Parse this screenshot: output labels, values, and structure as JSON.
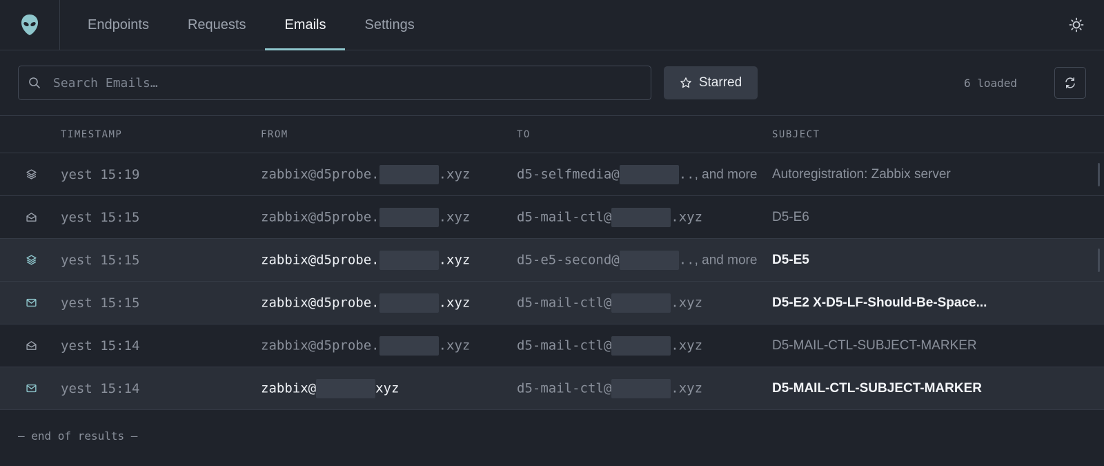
{
  "nav": {
    "tabs": [
      "Endpoints",
      "Requests",
      "Emails",
      "Settings"
    ],
    "active": "Emails"
  },
  "toolbar": {
    "search_placeholder": "Search Emails…",
    "starred_label": "Starred",
    "loaded_text": "6 loaded"
  },
  "table": {
    "headers": [
      "TIMESTAMP",
      "FROM",
      "TO",
      "SUBJECT"
    ],
    "rows": [
      {
        "icon": "layers-icon",
        "ts": "yest 15:19",
        "from_pre": "zabbix@d5probe.",
        "from_post": ".xyz",
        "to_pre": "d5-selfmedia@",
        "to_post": "..",
        "to_more": ", and more",
        "subject": "Autoregistration: Zabbix server"
      },
      {
        "icon": "mail-open-icon",
        "ts": "yest 15:15",
        "from_pre": "zabbix@d5probe.",
        "from_post": ".xyz",
        "to_pre": "d5-mail-ctl@",
        "to_post": ".xyz",
        "to_more": "",
        "subject": "D5-E6"
      },
      {
        "icon": "layers-icon",
        "ts": "yest 15:15",
        "from_pre": "zabbix@d5probe.",
        "from_post": ".xyz",
        "to_pre": "d5-e5-second@",
        "to_post": "..",
        "to_more": ", and more",
        "subject": "D5-E5"
      },
      {
        "icon": "mail-icon",
        "ts": "yest 15:15",
        "from_pre": "zabbix@d5probe.",
        "from_post": ".xyz",
        "to_pre": "d5-mail-ctl@",
        "to_post": ".xyz",
        "to_more": "",
        "subject": "D5-E2 X-D5-LF-Should-Be-Space..."
      },
      {
        "icon": "mail-open-icon",
        "ts": "yest 15:14",
        "from_pre": "zabbix@d5probe.",
        "from_post": ".xyz",
        "to_pre": "d5-mail-ctl@",
        "to_post": ".xyz",
        "to_more": "",
        "subject": "D5-MAIL-CTL-SUBJECT-MARKER"
      },
      {
        "icon": "mail-icon",
        "ts": "yest 15:14",
        "from_pre": "zabbix@",
        "from_post": "xyz",
        "to_pre": "d5-mail-ctl@",
        "to_post": ".xyz",
        "to_more": "",
        "subject": "D5-MAIL-CTL-SUBJECT-MARKER"
      }
    ]
  },
  "footer": {
    "text": "— end of results —"
  },
  "colors": {
    "accent": "#8ec6cc",
    "background": "#1f232b",
    "row_alt": "#2a2f38"
  }
}
